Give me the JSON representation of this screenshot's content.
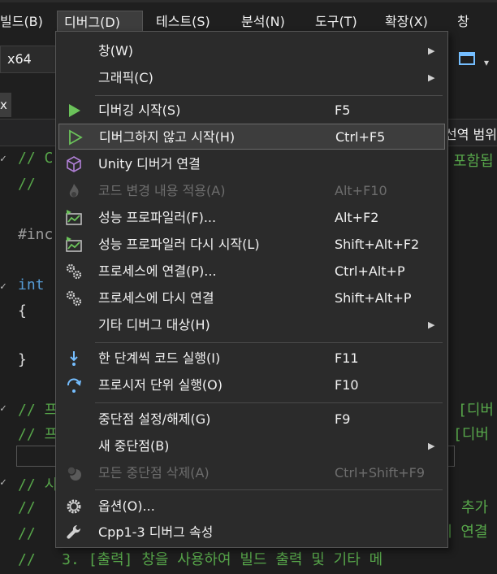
{
  "menubar": {
    "items": [
      "빌드(B)",
      "디버그(D)",
      "테스트(S)",
      "분석(N)",
      "도구(T)",
      "확장(X)",
      "창(W)"
    ]
  },
  "toolbar": {
    "platform": "x64"
  },
  "tab": {
    "label": "x"
  },
  "navbar": {
    "scope": "선역 범위"
  },
  "code": {
    "line1": "// C",
    "line1_tail": "포함됩",
    "line2": "//",
    "line3": "#inc",
    "line4_kw": "int",
    "line5": "{",
    "line6": "}",
    "line7": "// 프",
    "line7_tail": "[디버",
    "line8": "// 프",
    "line8_tail": "[디버",
    "line9": "// 시",
    "line10": "//",
    "line10_tail": "추가",
    "line11": "//",
    "line11_tail": "에 연결",
    "line12": "//   3. [출력] 창을 사용하여 빌드 출력 및 기타 메"
  },
  "debug_menu": {
    "items": [
      {
        "label": "창(W)",
        "shortcut": "",
        "submenu": true,
        "icon": "none",
        "disabled": false
      },
      {
        "label": "그래픽(C)",
        "shortcut": "",
        "submenu": true,
        "icon": "none",
        "disabled": false
      },
      {
        "label": "디버깅 시작(S)",
        "shortcut": "F5",
        "submenu": false,
        "icon": "play-filled-icon",
        "disabled": false
      },
      {
        "label": "디버그하지 않고 시작(H)",
        "shortcut": "Ctrl+F5",
        "submenu": false,
        "icon": "play-outline-icon",
        "disabled": false,
        "highlighted": true
      },
      {
        "label": "Unity 디버거 연결",
        "shortcut": "",
        "submenu": false,
        "icon": "cube-icon",
        "disabled": false
      },
      {
        "label": "코드 변경 내용 적용(A)",
        "shortcut": "Alt+F10",
        "submenu": false,
        "icon": "flame-icon",
        "disabled": true
      },
      {
        "label": "성능 프로파일러(F)...",
        "shortcut": "Alt+F2",
        "submenu": false,
        "icon": "profiler-icon",
        "disabled": false
      },
      {
        "label": "성능 프로파일러 다시 시작(L)",
        "shortcut": "Shift+Alt+F2",
        "submenu": false,
        "icon": "profiler-icon",
        "disabled": false
      },
      {
        "label": "프로세스에 연결(P)...",
        "shortcut": "Ctrl+Alt+P",
        "submenu": false,
        "icon": "gears-icon",
        "disabled": false
      },
      {
        "label": "프로세스에 다시 연결",
        "shortcut": "Shift+Alt+P",
        "submenu": false,
        "icon": "gears-icon",
        "disabled": false
      },
      {
        "label": "기타 디버그 대상(H)",
        "shortcut": "",
        "submenu": true,
        "icon": "none",
        "disabled": false
      },
      {
        "label": "한 단계씩 코드 실행(I)",
        "shortcut": "F11",
        "submenu": false,
        "icon": "step-into-icon",
        "disabled": false
      },
      {
        "label": "프로시저 단위 실행(O)",
        "shortcut": "F10",
        "submenu": false,
        "icon": "step-over-icon",
        "disabled": false
      },
      {
        "label": "중단점 설정/해제(G)",
        "shortcut": "F9",
        "submenu": false,
        "icon": "none",
        "disabled": false
      },
      {
        "label": "새 중단점(B)",
        "shortcut": "",
        "submenu": true,
        "icon": "none",
        "disabled": false
      },
      {
        "label": "모든 중단점 삭제(A)",
        "shortcut": "Ctrl+Shift+F9",
        "submenu": false,
        "icon": "breakpoints-icon",
        "disabled": true
      },
      {
        "label": "옵션(O)...",
        "shortcut": "",
        "submenu": false,
        "icon": "gear-icon",
        "disabled": false
      },
      {
        "label": "Cpp1-3 디버그 속성",
        "shortcut": "",
        "submenu": false,
        "icon": "wrench-icon",
        "disabled": false
      }
    ]
  },
  "colors": {
    "accent_green": "#6bc25a",
    "accent_blue": "#75beff",
    "comment_green": "#57a64a",
    "keyword_blue": "#569cd6"
  }
}
